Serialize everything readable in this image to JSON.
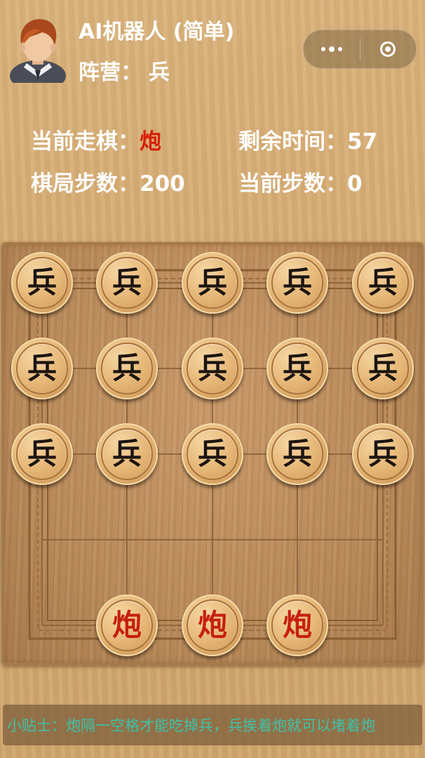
{
  "player": {
    "name": "AI机器人 (简单)",
    "side_label": "阵营：",
    "side_value": "兵"
  },
  "capsule": {
    "more_icon": "more-dots-icon",
    "close_icon": "close-circle-icon"
  },
  "status": {
    "current_turn_label": "当前走棋：",
    "current_turn_value": "炮",
    "time_left_label": "剩余时间：",
    "time_left_value": "57",
    "total_steps_label": "棋局步数：",
    "total_steps_value": "200",
    "current_step_label": "当前步数：",
    "current_step_value": "0"
  },
  "board": {
    "pieces": [
      {
        "text": "兵",
        "color": "black",
        "row": 0,
        "col": 0
      },
      {
        "text": "兵",
        "color": "black",
        "row": 0,
        "col": 1
      },
      {
        "text": "兵",
        "color": "black",
        "row": 0,
        "col": 2
      },
      {
        "text": "兵",
        "color": "black",
        "row": 0,
        "col": 3
      },
      {
        "text": "兵",
        "color": "black",
        "row": 0,
        "col": 4
      },
      {
        "text": "兵",
        "color": "black",
        "row": 1,
        "col": 0
      },
      {
        "text": "兵",
        "color": "black",
        "row": 1,
        "col": 1
      },
      {
        "text": "兵",
        "color": "black",
        "row": 1,
        "col": 2
      },
      {
        "text": "兵",
        "color": "black",
        "row": 1,
        "col": 3
      },
      {
        "text": "兵",
        "color": "black",
        "row": 1,
        "col": 4
      },
      {
        "text": "兵",
        "color": "black",
        "row": 2,
        "col": 0
      },
      {
        "text": "兵",
        "color": "black",
        "row": 2,
        "col": 1
      },
      {
        "text": "兵",
        "color": "black",
        "row": 2,
        "col": 2
      },
      {
        "text": "兵",
        "color": "black",
        "row": 2,
        "col": 3
      },
      {
        "text": "兵",
        "color": "black",
        "row": 2,
        "col": 4
      },
      {
        "text": "炮",
        "color": "red",
        "row": 4,
        "col": 1
      },
      {
        "text": "炮",
        "color": "red",
        "row": 4,
        "col": 2
      },
      {
        "text": "炮",
        "color": "red",
        "row": 4,
        "col": 3
      }
    ]
  },
  "tips": {
    "text": "小贴士：炮隔一空格才能吃掉兵，兵挨着炮就可以堵着炮"
  },
  "colors": {
    "red_piece_text": "#c6200e",
    "tips_text": "#3fc2a7"
  }
}
